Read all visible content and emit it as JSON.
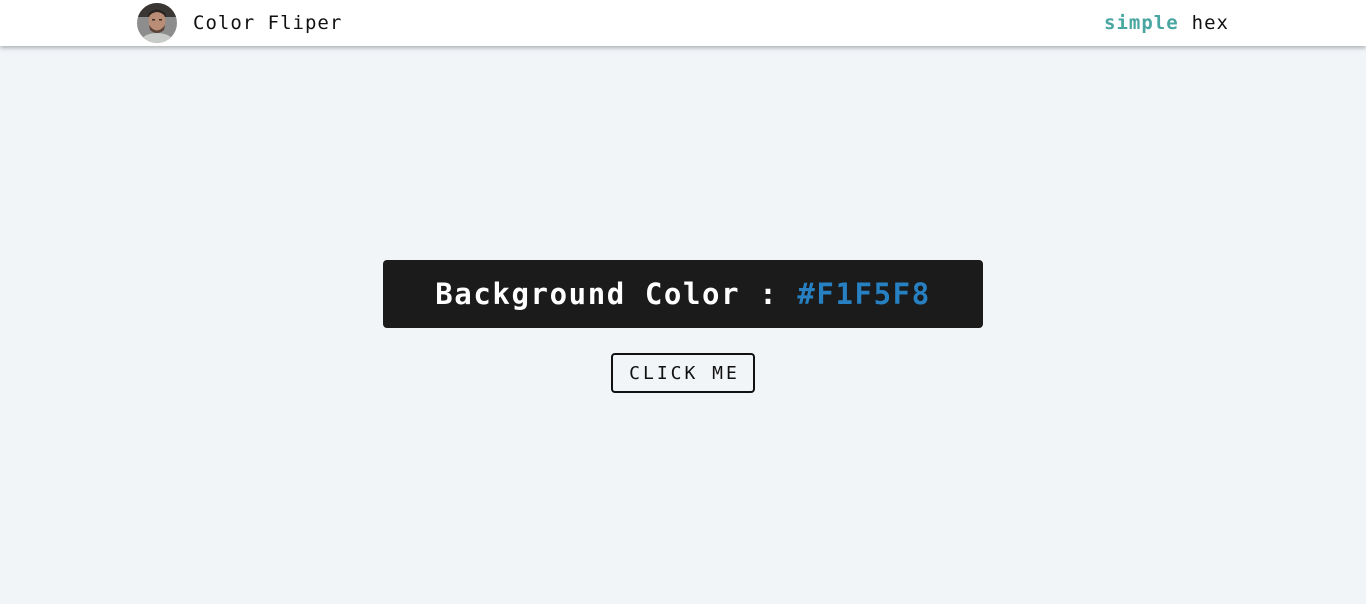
{
  "navbar": {
    "title": "Color Fliper",
    "avatar": "profile-photo",
    "links": [
      {
        "label": "simple",
        "active": true
      },
      {
        "label": "hex",
        "active": false
      }
    ]
  },
  "main": {
    "label": "Background Color :",
    "color_value": "#F1F5F8",
    "button_label": "CLICK ME"
  },
  "colors": {
    "background": "#F1F5F8",
    "panel": "#1b1b1b",
    "accent_value": "#2680c2",
    "active_link": "#49a6a0"
  }
}
